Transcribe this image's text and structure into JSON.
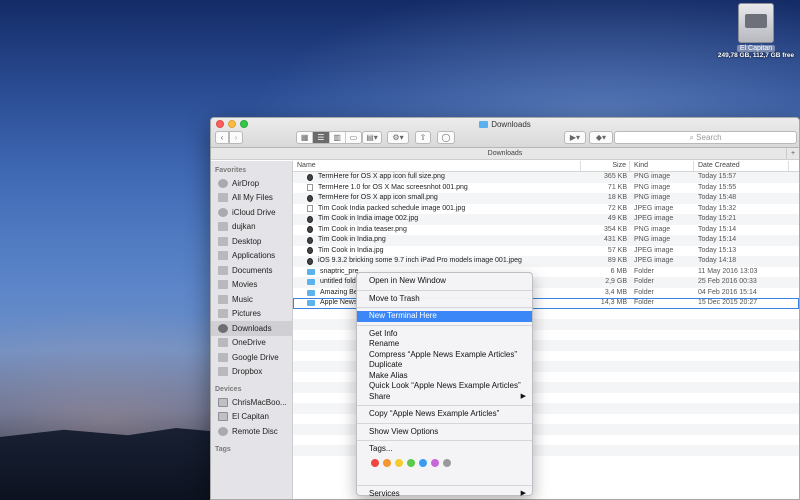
{
  "desktop": {
    "disk_name": "El Capitan",
    "disk_info": "249,78 GB, 112,7 GB free"
  },
  "window": {
    "title": "Downloads",
    "path_title": "Downloads",
    "search_placeholder": "Search",
    "back_icon": "‹",
    "forward_icon": "›"
  },
  "sidebar": {
    "favorites_header": "Favorites",
    "favorites": [
      {
        "label": "AirDrop",
        "icon": "airdrop-icon"
      },
      {
        "label": "All My Files",
        "icon": "all-files-icon"
      },
      {
        "label": "iCloud Drive",
        "icon": "cloud-icon"
      },
      {
        "label": "dujkan",
        "icon": "home-icon"
      },
      {
        "label": "Desktop",
        "icon": "desktop-icon"
      },
      {
        "label": "Applications",
        "icon": "applications-icon"
      },
      {
        "label": "Documents",
        "icon": "documents-icon"
      },
      {
        "label": "Movies",
        "icon": "movies-icon"
      },
      {
        "label": "Music",
        "icon": "music-icon"
      },
      {
        "label": "Pictures",
        "icon": "pictures-icon"
      },
      {
        "label": "Downloads",
        "icon": "downloads-icon"
      },
      {
        "label": "OneDrive",
        "icon": "folder-icon"
      },
      {
        "label": "Google Drive",
        "icon": "folder-icon"
      },
      {
        "label": "Dropbox",
        "icon": "folder-icon"
      }
    ],
    "devices_header": "Devices",
    "devices": [
      {
        "label": "ChrisMacBoo...",
        "icon": "laptop-icon"
      },
      {
        "label": "El Capitan",
        "icon": "disk-icon"
      },
      {
        "label": "Remote Disc",
        "icon": "disc-icon"
      }
    ],
    "tags_header": "Tags"
  },
  "columns": {
    "name": "Name",
    "size": "Size",
    "kind": "Kind",
    "date": "Date Created"
  },
  "files": [
    {
      "name": "TermHere for OS X app icon full size.png",
      "size": "365 KB",
      "kind": "PNG image",
      "date": "Today 15:57",
      "icon": "dark"
    },
    {
      "name": "TermHere 1.0 for OS X Mac screesnhot 001.png",
      "size": "71 KB",
      "kind": "PNG image",
      "date": "Today 15:55",
      "icon": "file"
    },
    {
      "name": "TermHere for OS X app icon small.png",
      "size": "18 KB",
      "kind": "PNG image",
      "date": "Today 15:48",
      "icon": "dark"
    },
    {
      "name": "Tim Cook India packed schedule image 001.jpg",
      "size": "72 KB",
      "kind": "JPEG image",
      "date": "Today 15:32",
      "icon": "file"
    },
    {
      "name": "Tim Cook in India image 002.jpg",
      "size": "49 KB",
      "kind": "JPEG image",
      "date": "Today 15:21",
      "icon": "dark"
    },
    {
      "name": "Tim Cook in India teaser.png",
      "size": "354 KB",
      "kind": "PNG image",
      "date": "Today 15:14",
      "icon": "dark"
    },
    {
      "name": "Tim Cook in India.png",
      "size": "431 KB",
      "kind": "PNG image",
      "date": "Today 15:14",
      "icon": "dark"
    },
    {
      "name": "Tim Cook in India.jpg",
      "size": "57 KB",
      "kind": "JPEG image",
      "date": "Today 15:13",
      "icon": "dark"
    },
    {
      "name": "iOS 9.3.2 bricking some 9.7 inch iPad Pro models image 001.jpeg",
      "size": "89 KB",
      "kind": "JPEG image",
      "date": "Today 14:18",
      "icon": "dark"
    },
    {
      "name": "snaptric_pre...",
      "size": "6 MB",
      "kind": "Folder",
      "date": "11 May 2016 13:03",
      "icon": "folder"
    },
    {
      "name": "untitled fold...",
      "size": "2,9 GB",
      "kind": "Folder",
      "date": "25 Feb 2016 00:33",
      "icon": "folder"
    },
    {
      "name": "Amazing Be...",
      "size": "3,4 MB",
      "kind": "Folder",
      "date": "04 Feb 2016 15:14",
      "icon": "folder"
    },
    {
      "name": "Apple News...",
      "size": "14,3 MB",
      "kind": "Folder",
      "date": "15 Dec 2015 20:27",
      "icon": "folder"
    }
  ],
  "context_menu": {
    "open_new_window": "Open in New Window",
    "move_to_trash": "Move to Trash",
    "new_terminal_here": "New Terminal Here",
    "get_info": "Get Info",
    "rename": "Rename",
    "compress": "Compress “Apple News Example Articles”",
    "duplicate": "Duplicate",
    "make_alias": "Make Alias",
    "quick_look": "Quick Look “Apple News Example Articles”",
    "share": "Share",
    "copy": "Copy “Apple News Example Articles”",
    "show_view_options": "Show View Options",
    "tags": "Tags...",
    "services": "Services",
    "submenu_arrow": "▶",
    "tag_colors": [
      "#f0463f",
      "#f7962c",
      "#f4cc2c",
      "#5bc94b",
      "#3a9cf0",
      "#c867d8",
      "#9a9a9e"
    ]
  },
  "colors": {
    "selection": "#3b87f7"
  }
}
